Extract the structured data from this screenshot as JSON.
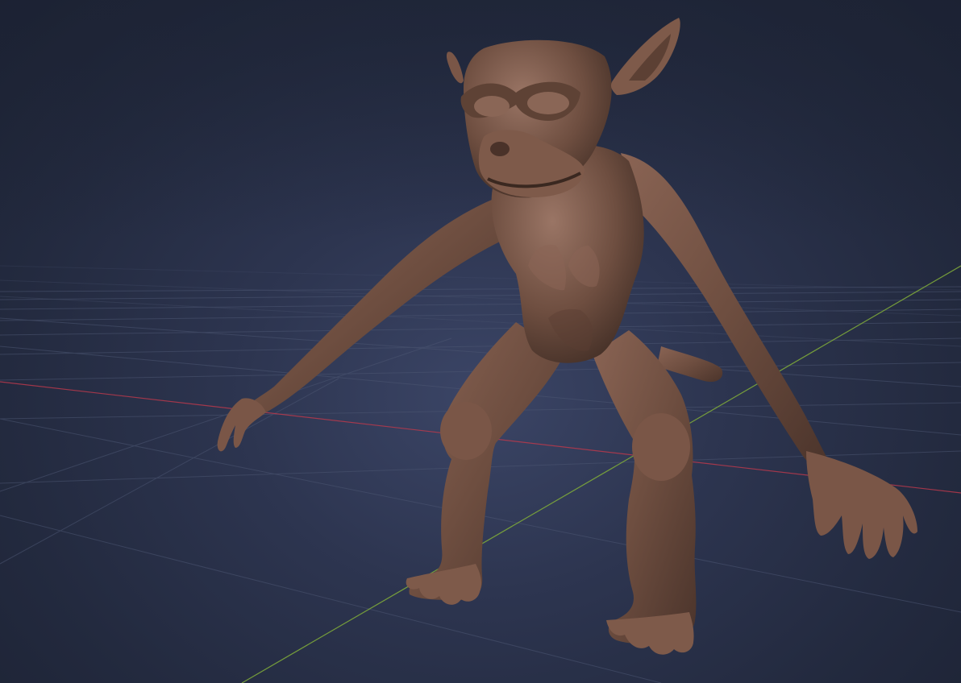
{
  "viewport": {
    "mode": "sculpt-viewport",
    "background_color": "#262d44",
    "grid_color": "#4c5672",
    "x_axis_color": "#b8394c",
    "y_axis_color": "#7da83a",
    "model_color": "#6e4e40",
    "model_shadow_color": "#3a2820",
    "model_highlight_color": "#9a7565"
  }
}
